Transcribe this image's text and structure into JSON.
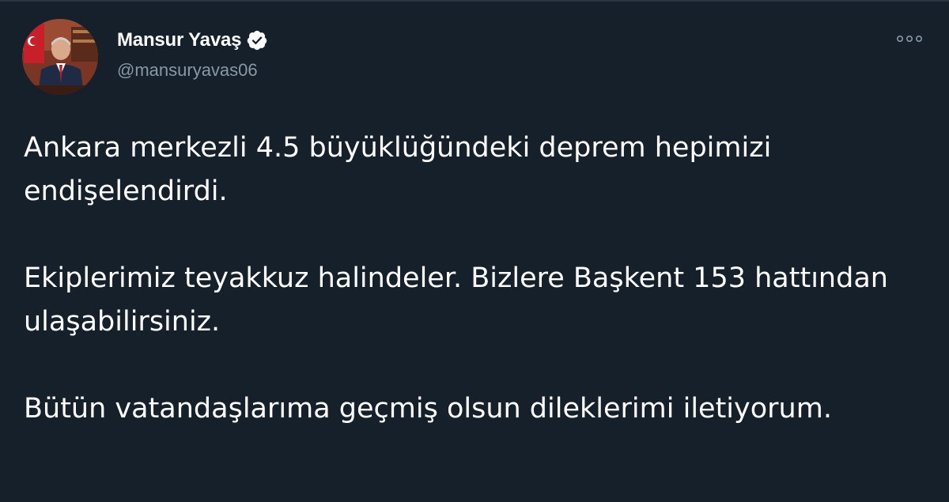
{
  "tweet": {
    "author": {
      "display_name": "Mansur Yavaş",
      "handle": "@mansuryavas06",
      "verified": true,
      "avatar_icon": "profile-photo"
    },
    "more_icon": "more-options-icon",
    "paragraphs": [
      "Ankara merkezli 4.5 büyüklüğündeki deprem hepimizi endişelendirdi.",
      "Ekiplerimiz teyakkuz halindeler. Bizlere Başkent 153 hattından ulaşabilirsiniz.",
      "Bütün vatandaşlarıma geçmiş olsun dileklerimi iletiyorum."
    ]
  },
  "colors": {
    "background": "#15202b",
    "text": "#ffffff",
    "secondary_text": "#8899a6",
    "verified_badge": "#ffffff"
  }
}
